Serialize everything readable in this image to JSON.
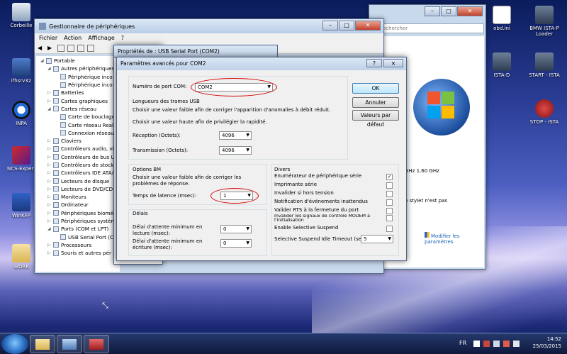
{
  "desktop": {
    "icons_left": [
      {
        "label": "Corbeille"
      },
      {
        "label": "ifhsrv32"
      },
      {
        "label": "INPA"
      },
      {
        "label": "NCS-Expert"
      },
      {
        "label": "WinKFP"
      },
      {
        "label": "WORK"
      }
    ],
    "icons_right": [
      {
        "label": "obd.ini"
      },
      {
        "label": "BMW ISTA-P Loader"
      },
      {
        "label": "ISTA-D"
      },
      {
        "label": "START - ISTA"
      },
      {
        "label": "STOP - ISTA"
      }
    ]
  },
  "device_manager": {
    "title": "Gestionnaire de périphériques",
    "menu": [
      "Fichier",
      "Action",
      "Affichage",
      "?"
    ],
    "tree": [
      {
        "label": "Portable",
        "level": 0,
        "expander": "◢"
      },
      {
        "label": "Autres périphériques",
        "level": 1,
        "expander": "◢"
      },
      {
        "label": "Périphérique inco",
        "level": 2,
        "expander": ""
      },
      {
        "label": "Périphérique inco",
        "level": 2,
        "expander": ""
      },
      {
        "label": "Batteries",
        "level": 1,
        "expander": "▷"
      },
      {
        "label": "Cartes graphiques",
        "level": 1,
        "expander": "▷"
      },
      {
        "label": "Cartes réseau",
        "level": 1,
        "expander": "◢"
      },
      {
        "label": "Carte de bouclage",
        "level": 2,
        "expander": ""
      },
      {
        "label": "Carte réseau Realt",
        "level": 2,
        "expander": ""
      },
      {
        "label": "Connexion réseau",
        "level": 2,
        "expander": ""
      },
      {
        "label": "Claviers",
        "level": 1,
        "expander": "▷"
      },
      {
        "label": "Contrôleurs audio, vid",
        "level": 1,
        "expander": "▷"
      },
      {
        "label": "Contrôleurs de bus US",
        "level": 1,
        "expander": "▷"
      },
      {
        "label": "Contrôleurs de stocka",
        "level": 1,
        "expander": "▷"
      },
      {
        "label": "Contrôleurs IDE ATA/",
        "level": 1,
        "expander": "▷"
      },
      {
        "label": "Lecteurs de disque",
        "level": 1,
        "expander": "▷"
      },
      {
        "label": "Lecteurs de DVD/CD-R",
        "level": 1,
        "expander": "▷"
      },
      {
        "label": "Moniteurs",
        "level": 1,
        "expander": "▷"
      },
      {
        "label": "Ordinateur",
        "level": 1,
        "expander": "▷"
      },
      {
        "label": "Périphériques biomét",
        "level": 1,
        "expander": "▷"
      },
      {
        "label": "Périphériques systèm",
        "level": 1,
        "expander": "▷"
      },
      {
        "label": "Ports (COM et LPT)",
        "level": 1,
        "expander": "◢"
      },
      {
        "label": "USB Serial Port (C",
        "level": 2,
        "expander": ""
      },
      {
        "label": "Processeurs",
        "level": 1,
        "expander": "▷"
      },
      {
        "label": "Souris et autres pér",
        "level": 1,
        "expander": "▷"
      }
    ]
  },
  "background_window": {
    "search_placeholder": "echercher",
    "cpu_text": "GHz   1.60 GHz",
    "pen_text": "n stylet n'est pas",
    "change_link": "Modifier les paramètres"
  },
  "props_dialog": {
    "title": "Propriétés de : USB Serial Port (COM2)"
  },
  "adv_dialog": {
    "title": "Paramètres avancés pour COM2",
    "port_label": "Numéro de port COM:",
    "port_value": "COM2",
    "usb_group_title": "Longueurs des trames USB",
    "usb_hint1": "Choisir une valeur faible afin de corriger  l'apparition d'anomalies à débit réduit.",
    "usb_hint2": "Choisir une valeur haute afin de privilégier la rapidité.",
    "rx_label": "Réception (Octets):",
    "rx_value": "4096",
    "tx_label": "Transmission (Octets):",
    "tx_value": "4096",
    "bm_group_title": "Options BM",
    "bm_hint": "Choisir une valeur faible afin de corriger les problèmes de réponse.",
    "latency_label": "Temps de latence (msec):",
    "latency_value": "1",
    "delays_group_title": "Délais",
    "read_delay_label": "Délai d'attente minimum en lecture (msec):",
    "read_delay_value": "0",
    "write_delay_label": "Délai d'attente minimum en écriture (msec):",
    "write_delay_value": "0",
    "misc_group_title": "Divers",
    "misc_options": [
      {
        "label": "Enumérateur de périphérique série",
        "checked": true
      },
      {
        "label": "Imprimante série",
        "checked": false
      },
      {
        "label": "Invalider si hors tension",
        "checked": false
      },
      {
        "label": "Notification d'événements inattendus",
        "checked": false
      },
      {
        "label": "Valider RTS à la fermeture du port",
        "checked": false
      },
      {
        "label": "Invalider les signaux de contrôle MODEM à l'initialisation",
        "checked": false
      },
      {
        "label": "Enable Selective Suspend",
        "checked": false
      }
    ],
    "suspend_label": "Selective Suspend Idle Timeout (secs):",
    "suspend_value": "5",
    "ok_label": "OK",
    "cancel_label": "Annuler",
    "defaults_label": "Valeurs par défaut",
    "help_glyph": "?",
    "close_glyph": "✕"
  },
  "taskbar": {
    "lang": "FR",
    "time": "14:52",
    "date": "25/03/2015"
  }
}
